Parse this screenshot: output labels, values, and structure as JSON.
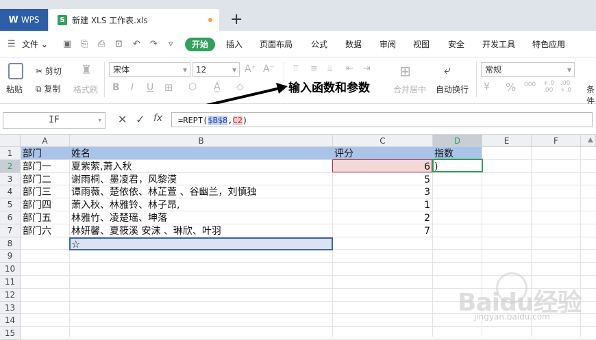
{
  "title_bar": {
    "app_tab": "WPS",
    "doc_tab": "新建 XLS 工作表.xls",
    "new_tab": "+"
  },
  "menu": {
    "file": "文件",
    "tabs": [
      "开始",
      "插入",
      "页面布局",
      "公式",
      "数据",
      "审阅",
      "视图",
      "安全",
      "开发工具",
      "特色应用"
    ]
  },
  "ribbon": {
    "paste": "粘贴",
    "cut": "剪切",
    "copy": "复制",
    "format_painter": "格式刷",
    "font_name": "宋体",
    "font_size": "12",
    "merge_center": "合并居中",
    "auto_wrap": "自动换行",
    "number_format": "常规",
    "conditional": "条件",
    "bold": "B",
    "italic": "I",
    "underline": "U",
    "percent": "%",
    "thousands": "000",
    "dec_inc": "+.0\n.00",
    "dec_dec": ".00\n+.0"
  },
  "annotation": {
    "text": "输入函数和参数"
  },
  "formula_bar": {
    "name_box": "IF",
    "fx": "fx",
    "formula_prefix": "=REPT(",
    "ref1": "$B$8",
    "comma": ",",
    "ref2": "C2",
    "formula_suffix": ")"
  },
  "sheet": {
    "columns": [
      "A",
      "B",
      "C",
      "D",
      "E",
      "F"
    ],
    "rows": [
      "1",
      "2",
      "3",
      "4",
      "5",
      "6",
      "7",
      "8",
      "9",
      "10",
      "11",
      "12",
      "13",
      "14",
      "15"
    ],
    "header_row": {
      "A": "部门",
      "B": "姓名",
      "C": "评分",
      "D": "指数"
    },
    "data": [
      {
        "A": "部门一",
        "B": "夏紫萦,萧入秋",
        "C": "6",
        "D": ")"
      },
      {
        "A": "部门二",
        "B": "谢雨桐、墨凌君，风黎漠",
        "C": "5",
        "D": ""
      },
      {
        "A": "部门三",
        "B": "谭雨薇、楚依依、林芷萱 、谷幽兰，刘慎独",
        "C": "3",
        "D": ""
      },
      {
        "A": "部门四",
        "B": "萧入秋、林雅铃、林子昂,",
        "C": "1",
        "D": ""
      },
      {
        "A": "部门五",
        "B": "林雅竹、凌楚瑶、坤落",
        "C": "2",
        "D": ""
      },
      {
        "A": "部门六",
        "B": "林妍馨、夏筱溪 安沫 、琳欣、叶羽",
        "C": "7",
        "D": ""
      }
    ],
    "b8": "☆"
  },
  "watermark": {
    "brand": "Baidu经验",
    "url": "jingyan.baidu.com"
  },
  "colors": {
    "accent_green": "#2ea25a",
    "wps_blue": "#2d5fa8",
    "header_fill": "#a9c4e8",
    "ref_red_fill": "#f4d7d9",
    "b8_fill": "#dbe3f3"
  }
}
